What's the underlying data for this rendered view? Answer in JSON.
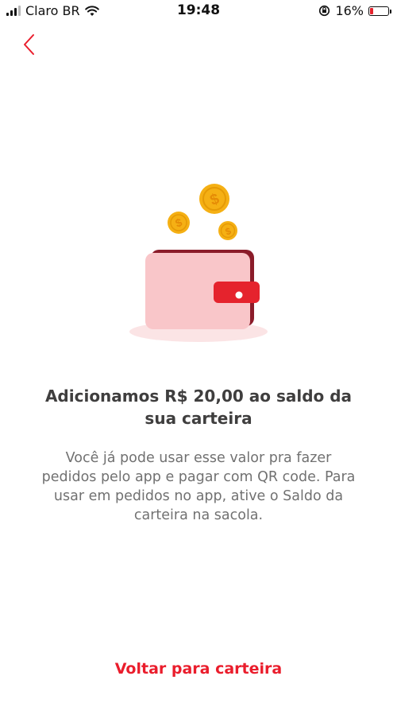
{
  "status_bar": {
    "carrier": "Claro BR",
    "time": "19:48",
    "battery": "16%",
    "icons": [
      "signal-icon",
      "wifi-icon",
      "orientation-lock-icon",
      "battery-icon"
    ]
  },
  "navigation": {
    "back_icon": "chevron-left-icon"
  },
  "illustration": {
    "name": "wallet-with-coins",
    "coin_symbol": "$"
  },
  "content": {
    "headline": "Adicionamos R$ 20,00 ao saldo da sua carteira",
    "description": "Você já pode usar esse valor pra fazer pedidos pelo app e pagar com QR code. Para usar em pedidos no app, ative o Saldo da carteira na sacola."
  },
  "actions": {
    "back_to_wallet": "Voltar para carteira"
  },
  "colors": {
    "accent": "#ea1d2c",
    "wallet_body": "#f9c6c9",
    "wallet_dark": "#8b1c2a",
    "coin": "#f5b014",
    "text_primary": "#3f3e3e",
    "text_secondary": "#717171"
  }
}
